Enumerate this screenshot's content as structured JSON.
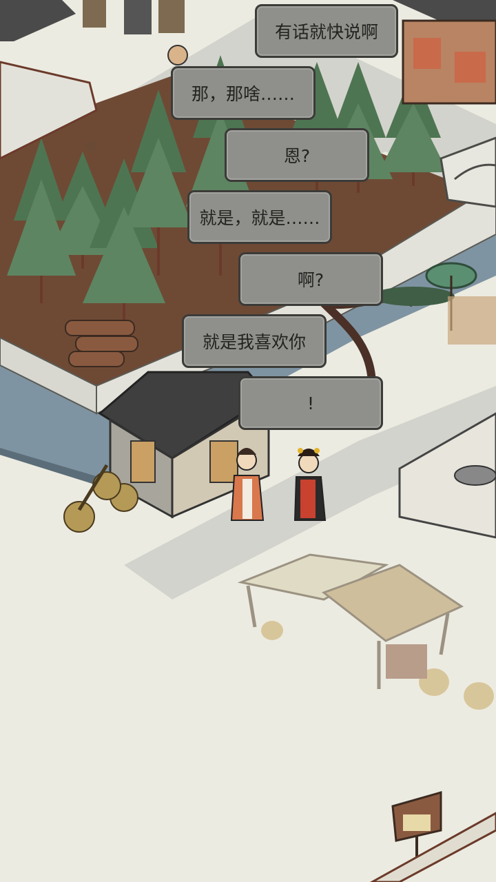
{
  "dialogue": [
    {
      "speaker": "left",
      "text": "有话就快说啊"
    },
    {
      "speaker": "right",
      "text": "那，那啥……"
    },
    {
      "speaker": "left",
      "text": "恩?"
    },
    {
      "speaker": "right",
      "text": "就是，就是……"
    },
    {
      "speaker": "left",
      "text": "啊?"
    },
    {
      "speaker": "right",
      "text": "就是我喜欢你"
    },
    {
      "speaker": "left",
      "text": "!"
    }
  ],
  "colors": {
    "ground": "#ecebe1",
    "bubble_fill": "#8f8f8b",
    "bubble_border": "#3b3b38",
    "soil": "#6e4a35",
    "pine": "#4e7552",
    "water": "#7f94a2",
    "roof": "#4a4a4a"
  },
  "characters": [
    "woman-in-orange-robe-icon",
    "woman-in-red-robe-icon"
  ]
}
